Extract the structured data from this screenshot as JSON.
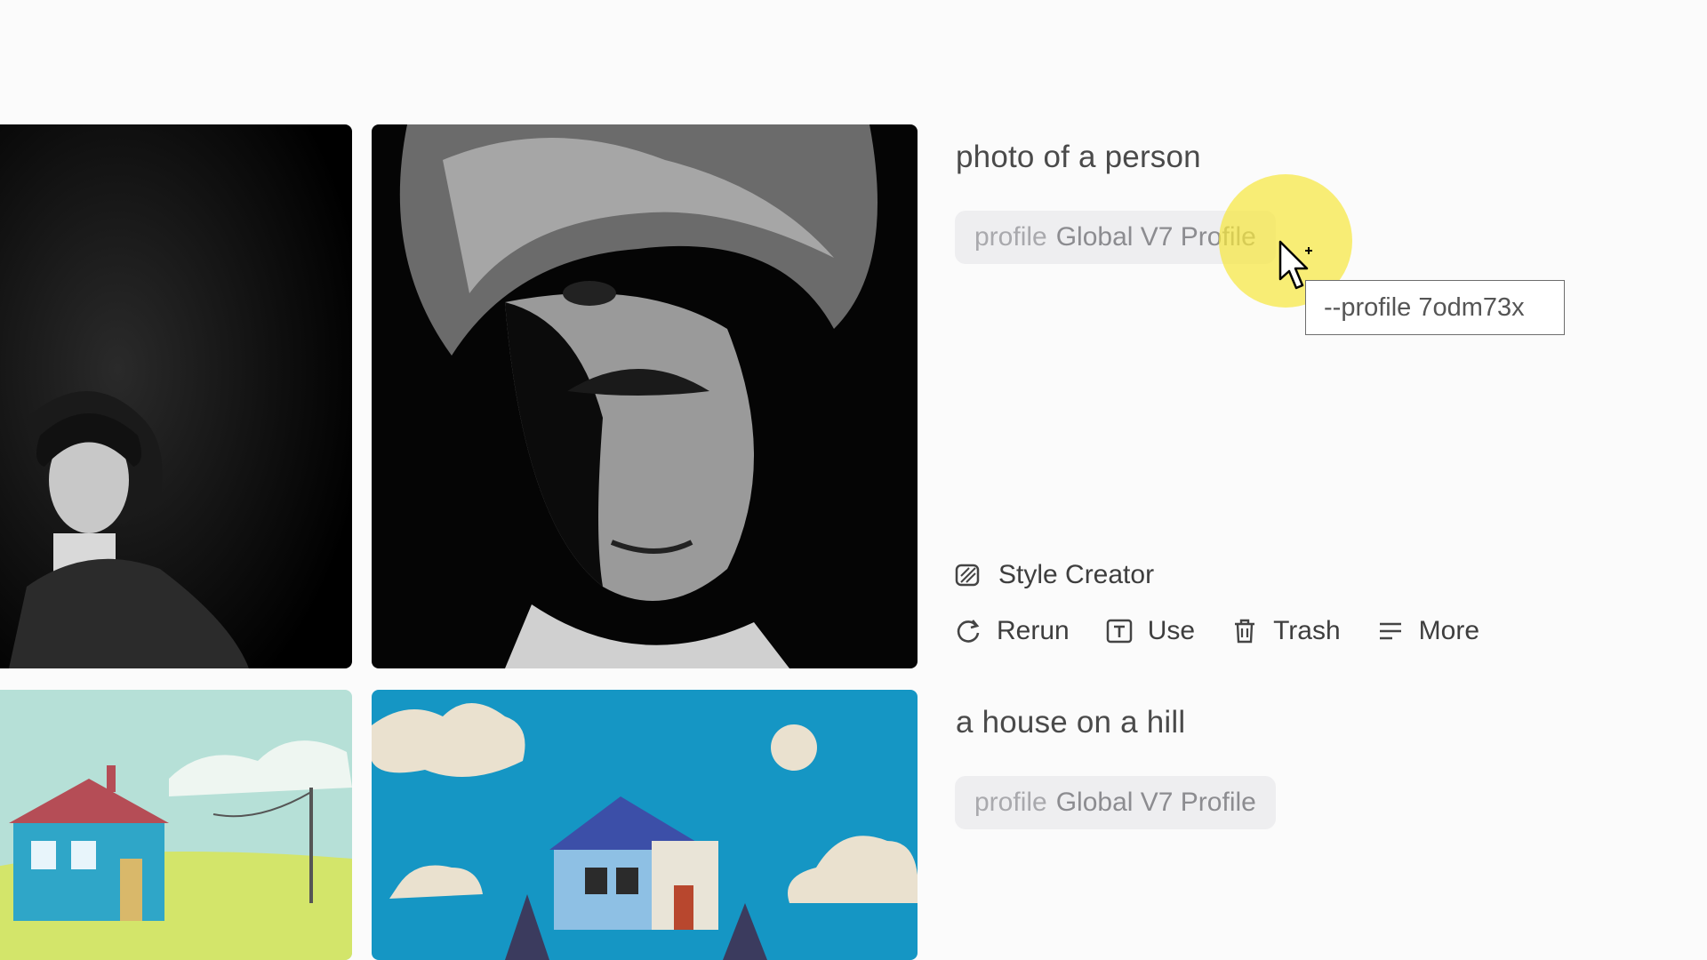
{
  "entries": [
    {
      "prompt": "photo of a person",
      "profile_keyword": "profile",
      "profile_name": "Global V7 Profile",
      "tooltip": "--profile 7odm73x"
    },
    {
      "prompt": "a house on a hill",
      "profile_keyword": "profile",
      "profile_name": "Global V7 Profile"
    }
  ],
  "style_creator_label": "Style Creator",
  "actions": {
    "rerun": "Rerun",
    "use": "Use",
    "trash": "Trash",
    "more": "More"
  },
  "colors": {
    "background": "#fbfbfb",
    "pill": "#eeeef0",
    "cursor_highlight": "#f7e73c"
  },
  "icons": [
    "style-creator-icon",
    "rerun-icon",
    "use-icon",
    "trash-icon",
    "more-icon",
    "pointer-cursor-icon"
  ]
}
